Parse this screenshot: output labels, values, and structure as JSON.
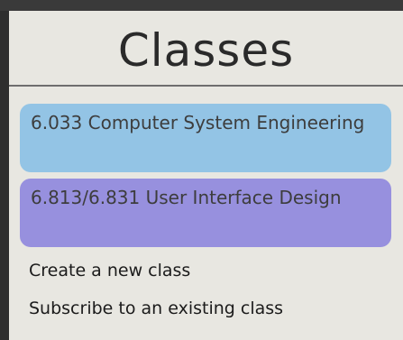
{
  "panel": {
    "title": "Classes"
  },
  "classes": [
    {
      "label": "6.033 Computer System Engineering",
      "color": "#93c4e5"
    },
    {
      "label": "6.813/6.831 User Interface Design",
      "color": "#9790de"
    }
  ],
  "actions": {
    "create_label": "Create a new class",
    "subscribe_label": "Subscribe to an existing class"
  },
  "colors": {
    "panel_background": "#e8e7e1",
    "frame": "#2e2e2e"
  }
}
